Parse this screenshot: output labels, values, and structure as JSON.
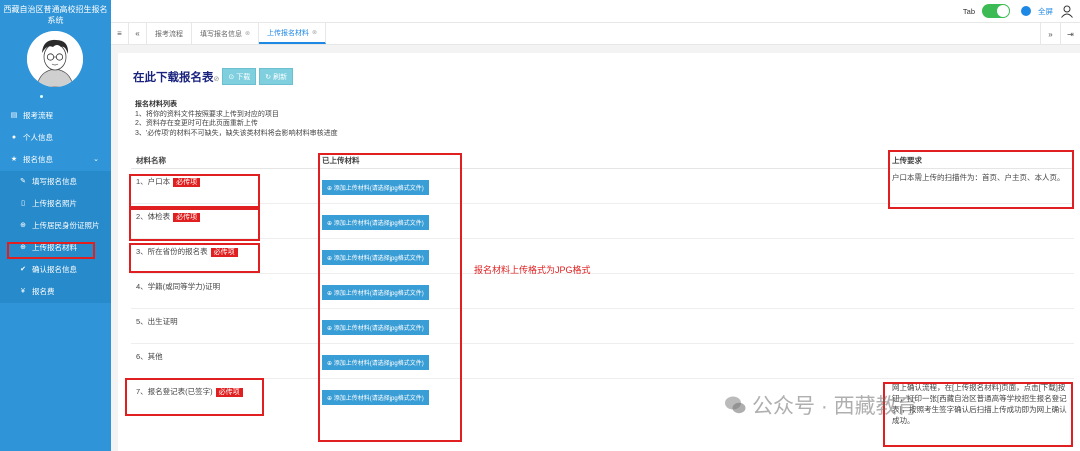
{
  "sidebar": {
    "system_title": "西藏自治区普通高校招生报名系统",
    "menu": [
      {
        "icon": "list-icon",
        "label": "报考流程"
      },
      {
        "icon": "person-icon",
        "label": "个人信息"
      },
      {
        "icon": "star-icon",
        "label": "报名信息"
      }
    ],
    "submenu": [
      {
        "icon": "edit-icon",
        "label": "填写报名信息"
      },
      {
        "icon": "file-icon",
        "label": "上传报名照片"
      },
      {
        "icon": "upload-circle-icon",
        "label": "上传居民身份证照片"
      },
      {
        "icon": "upload-circle-icon",
        "label": "上传报名材料"
      },
      {
        "icon": "check-icon",
        "label": "确认报名信息"
      },
      {
        "icon": "yen-icon",
        "label": "报名费"
      }
    ]
  },
  "topbar": {
    "tab_toggle_label": "Tab",
    "fullscreen_label": "全屏"
  },
  "tabs": [
    {
      "label": "报考流程",
      "closable": false
    },
    {
      "label": "填写报名信息",
      "closable": true
    },
    {
      "label": "上传报名材料",
      "closable": true,
      "active": true
    }
  ],
  "main": {
    "download_title": "在此下载报名表",
    "download_button": "下载",
    "refresh_button": "刷新",
    "instructions_title": "报名材料列表",
    "instructions": [
      "1、将你的资料文件按照要求上传到对应的项目",
      "2、资料存在变更时可在此页面重新上传",
      "3、'必传项'的材料不可缺失，缺失该类材料将会影响材料审核进度"
    ],
    "columns": [
      "材料名称",
      "已上传材料",
      "上传要求"
    ],
    "upload_button": "添加上传材料(请选择jpg格式文件)",
    "required_tag": "必传项",
    "rows": [
      {
        "name": "1、户口本",
        "required": true,
        "requirement": "户口本需上传的扫描件为：首页、户主页、本人页。"
      },
      {
        "name": "2、体检表",
        "required": true,
        "requirement": ""
      },
      {
        "name": "3、所在省份的报名表",
        "required": true,
        "requirement": ""
      },
      {
        "name": "4、学籍(或同等学力)证明",
        "required": false,
        "requirement": ""
      },
      {
        "name": "5、出生证明",
        "required": false,
        "requirement": ""
      },
      {
        "name": "6、其他",
        "required": false,
        "requirement": ""
      },
      {
        "name": "7、报名登记表(已签字)",
        "required": true,
        "requirement": "网上确认流程，在[上传报名材料]页面，点击[下载]按钮，打印一张[西藏自治区普通高等学校招生报名登记表]，按照考生签字确认后扫描上传成功即为网上确认成功。"
      }
    ],
    "annotation": "报名材料上传格式为JPG格式"
  },
  "watermark": "公众号 · 西藏教育"
}
